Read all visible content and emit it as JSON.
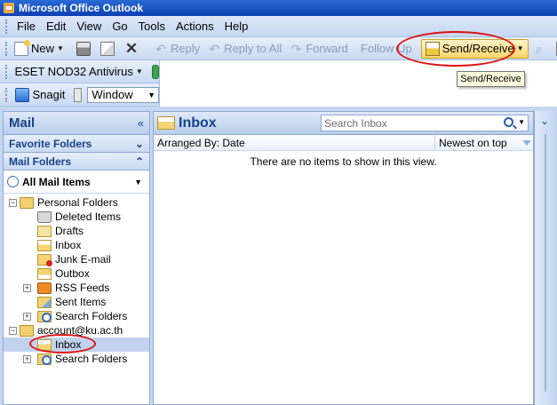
{
  "window": {
    "title": "Microsoft Office Outlook"
  },
  "menu": [
    "File",
    "Edit",
    "View",
    "Go",
    "Tools",
    "Actions",
    "Help"
  ],
  "toolbar": {
    "new_label": "New",
    "reply_label": "Reply",
    "reply_all_label": "Reply to All",
    "forward_label": "Forward",
    "follow_up_label": "Follow Up",
    "send_receive_label": "Send/Receive",
    "tooltip": "Send/Receive"
  },
  "eset_toolbar": {
    "label": "ESET NOD32 Antivirus"
  },
  "snagit_toolbar": {
    "label": "Snagit",
    "mode_value": "Window"
  },
  "navigation": {
    "title": "Mail",
    "favorite_folders": "Favorite Folders",
    "mail_folders": "Mail Folders",
    "all_mail_items": "All Mail Items",
    "personal_folders": {
      "label": "Personal Folders",
      "children": [
        "Deleted Items",
        "Drafts",
        "Inbox",
        "Junk E-mail",
        "Outbox",
        "RSS Feeds",
        "Sent Items",
        "Search Folders"
      ]
    },
    "account": {
      "label": "account@ku.ac.th",
      "children": [
        "Inbox",
        "Search Folders"
      ]
    }
  },
  "inbox": {
    "title": "Inbox",
    "search_placeholder": "Search Inbox",
    "arranged_by": "Arranged By: Date",
    "sort_order": "Newest on top",
    "empty_message": "There are no items to show in this view."
  },
  "colors": {
    "highlight_ring": "#e01010",
    "header_text": "#15428b"
  }
}
